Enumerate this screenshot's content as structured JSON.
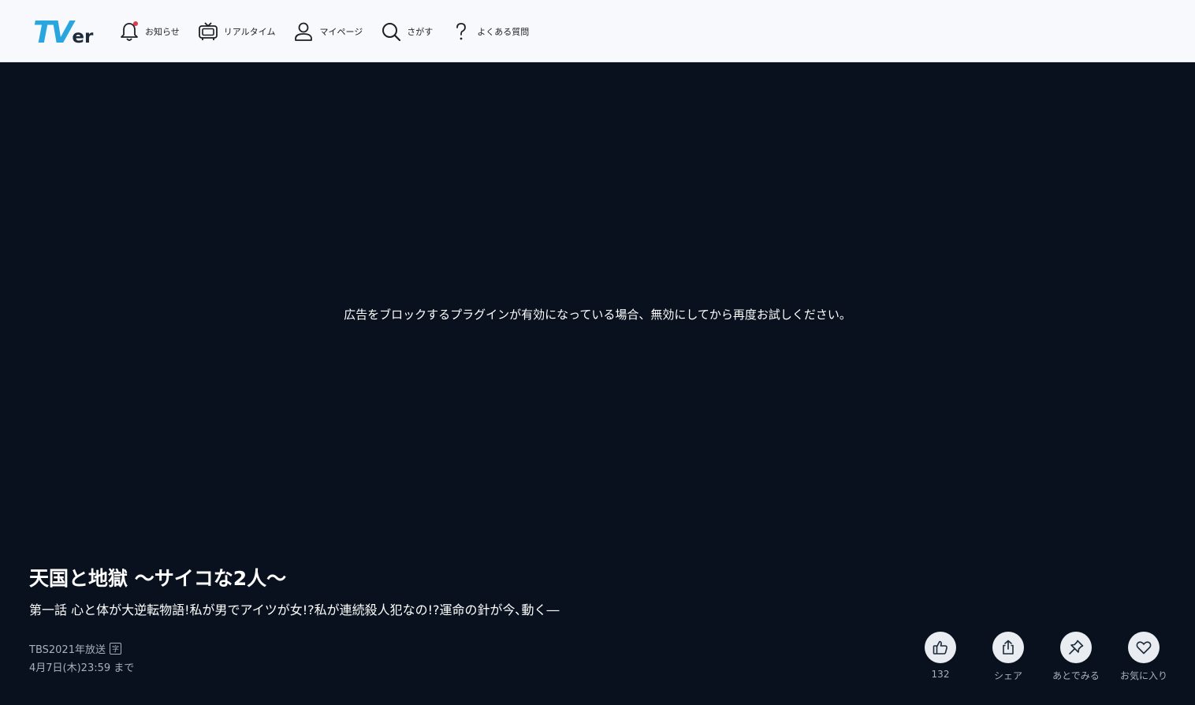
{
  "header": {
    "logo_main": "TV",
    "logo_suffix": "er",
    "nav": [
      {
        "label": "お知らせ",
        "icon": "bell-icon"
      },
      {
        "label": "リアルタイム",
        "icon": "tv-icon"
      },
      {
        "label": "マイページ",
        "icon": "user-icon"
      },
      {
        "label": "さがす",
        "icon": "search-icon"
      },
      {
        "label": "よくある質問",
        "icon": "question-icon"
      }
    ]
  },
  "player": {
    "message": "広告をブロックするプラグインが有効になっている場合、無効にしてから再度お試しください。"
  },
  "program": {
    "title": "天国と地獄 〜サイコな2人〜",
    "episode": "第一話 心と体が大逆転物語!私が男でアイツが女!?私が連続殺人犯なの!?運命の針が今､動く―",
    "broadcast": "TBS2021年放送",
    "caption_badge": "字",
    "expiry": "4月7日(木)23:59 まで"
  },
  "actions": [
    {
      "label": "132",
      "icon": "thumbs-up-icon"
    },
    {
      "label": "シェア",
      "icon": "share-icon"
    },
    {
      "label": "あとでみる",
      "icon": "pin-icon"
    },
    {
      "label": "お気に入り",
      "icon": "heart-icon"
    }
  ],
  "colors": {
    "background": "#08111d",
    "header_bg": "#f7f9fc",
    "logo_accent": "#2aa6df",
    "notification_dot": "#e5384b",
    "muted_text": "#a8b0bb"
  }
}
